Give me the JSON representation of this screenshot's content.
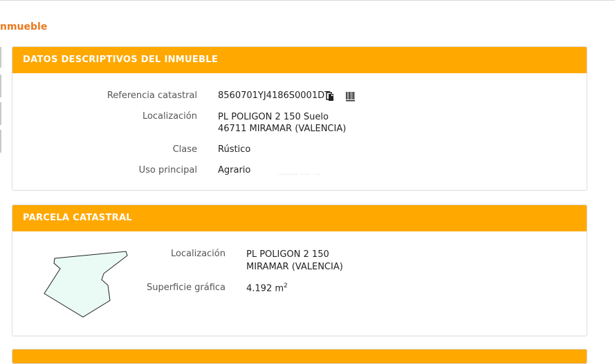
{
  "page": {
    "title": "nmueble"
  },
  "panel1": {
    "header": "DATOS DESCRIPTIVOS DEL INMUEBLE",
    "rows": [
      {
        "label": "Referencia catastral",
        "value": "8560701YJ4186S0001DT"
      },
      {
        "label": "Localización",
        "value": "PL POLIGON 2 150 Suelo\n46711 MIRAMAR (VALENCIA)"
      },
      {
        "label": "Clase",
        "value": "Rústico"
      },
      {
        "label": "Uso principal",
        "value": "Agrario"
      }
    ],
    "faded_text": "········ ···· ···"
  },
  "panel2": {
    "header": "PARCELA CATASTRAL",
    "rows": [
      {
        "label": "Localización",
        "value": "PL POLIGON 2 150\nMIRAMAR (VALENCIA)"
      },
      {
        "label": "Superficie gráfica",
        "value": "4.192 m",
        "unit_sup": "2"
      }
    ]
  },
  "icons": [
    "copy-icon",
    "barcode-icon"
  ],
  "colors": {
    "header_bg": "#ffa800",
    "title": "#e87a1e",
    "parcel_fill": "#eafaf4"
  }
}
